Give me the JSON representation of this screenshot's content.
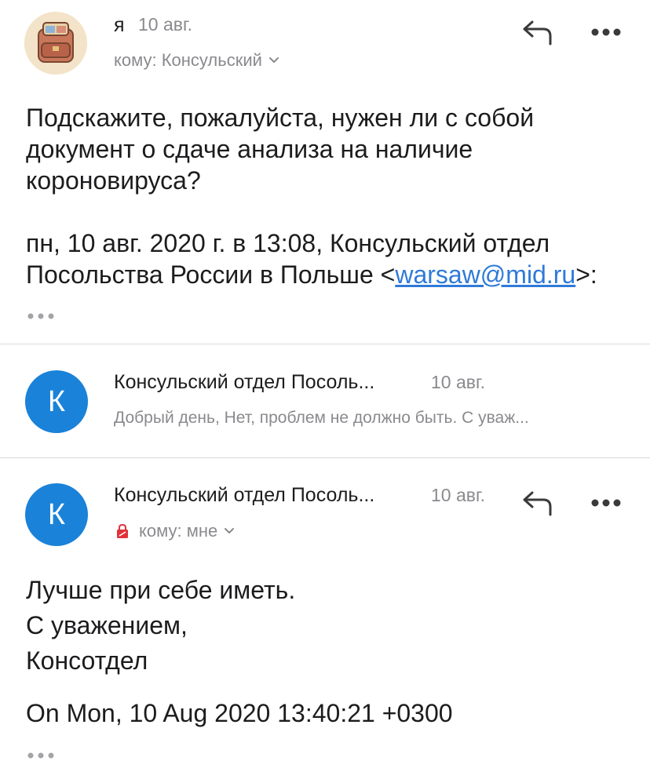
{
  "message1": {
    "sender": "я",
    "date": "10 авг.",
    "recipient_prefix": "кому:",
    "recipient": "Консульский",
    "body_line1": "Подскажите, пожалуйста, нужен ли с собой",
    "body_line2": "документ о сдаче анализа на наличие",
    "body_line3": "короновируса?",
    "quote_line1": "пн, 10 авг. 2020 г. в 13:08, Консульский отдел",
    "quote_line2_prefix": "Посольства России в Польше <",
    "quote_email": "warsaw@mid.ru",
    "quote_line2_suffix": ">:"
  },
  "message2": {
    "avatar_letter": "К",
    "sender": "Консульский отдел Посоль...",
    "date": "10 авг.",
    "preview": "Добрый день, Нет, проблем не должно быть. С уваж..."
  },
  "message3": {
    "avatar_letter": "К",
    "sender": "Консульский отдел Посоль...",
    "date": "10 авг.",
    "recipient_prefix": "кому:",
    "recipient": "мне",
    "body_line1": "Лучше при себе иметь.",
    "body_line2": "С уважением,",
    "body_line3": "Консотдел",
    "quote_line1": "On Mon, 10 Aug 2020 13:40:21 +0300"
  },
  "icons": {
    "reply": "reply-arrow-icon",
    "more": "more-dots-icon",
    "expand": "chevron-down-icon",
    "lock": "red-lock-icon"
  },
  "colors": {
    "avatar_blue": "#1a82d8",
    "link_blue": "#2f7ad8",
    "secondary_text": "#8a8a8e",
    "lock_red": "#e0323a"
  }
}
